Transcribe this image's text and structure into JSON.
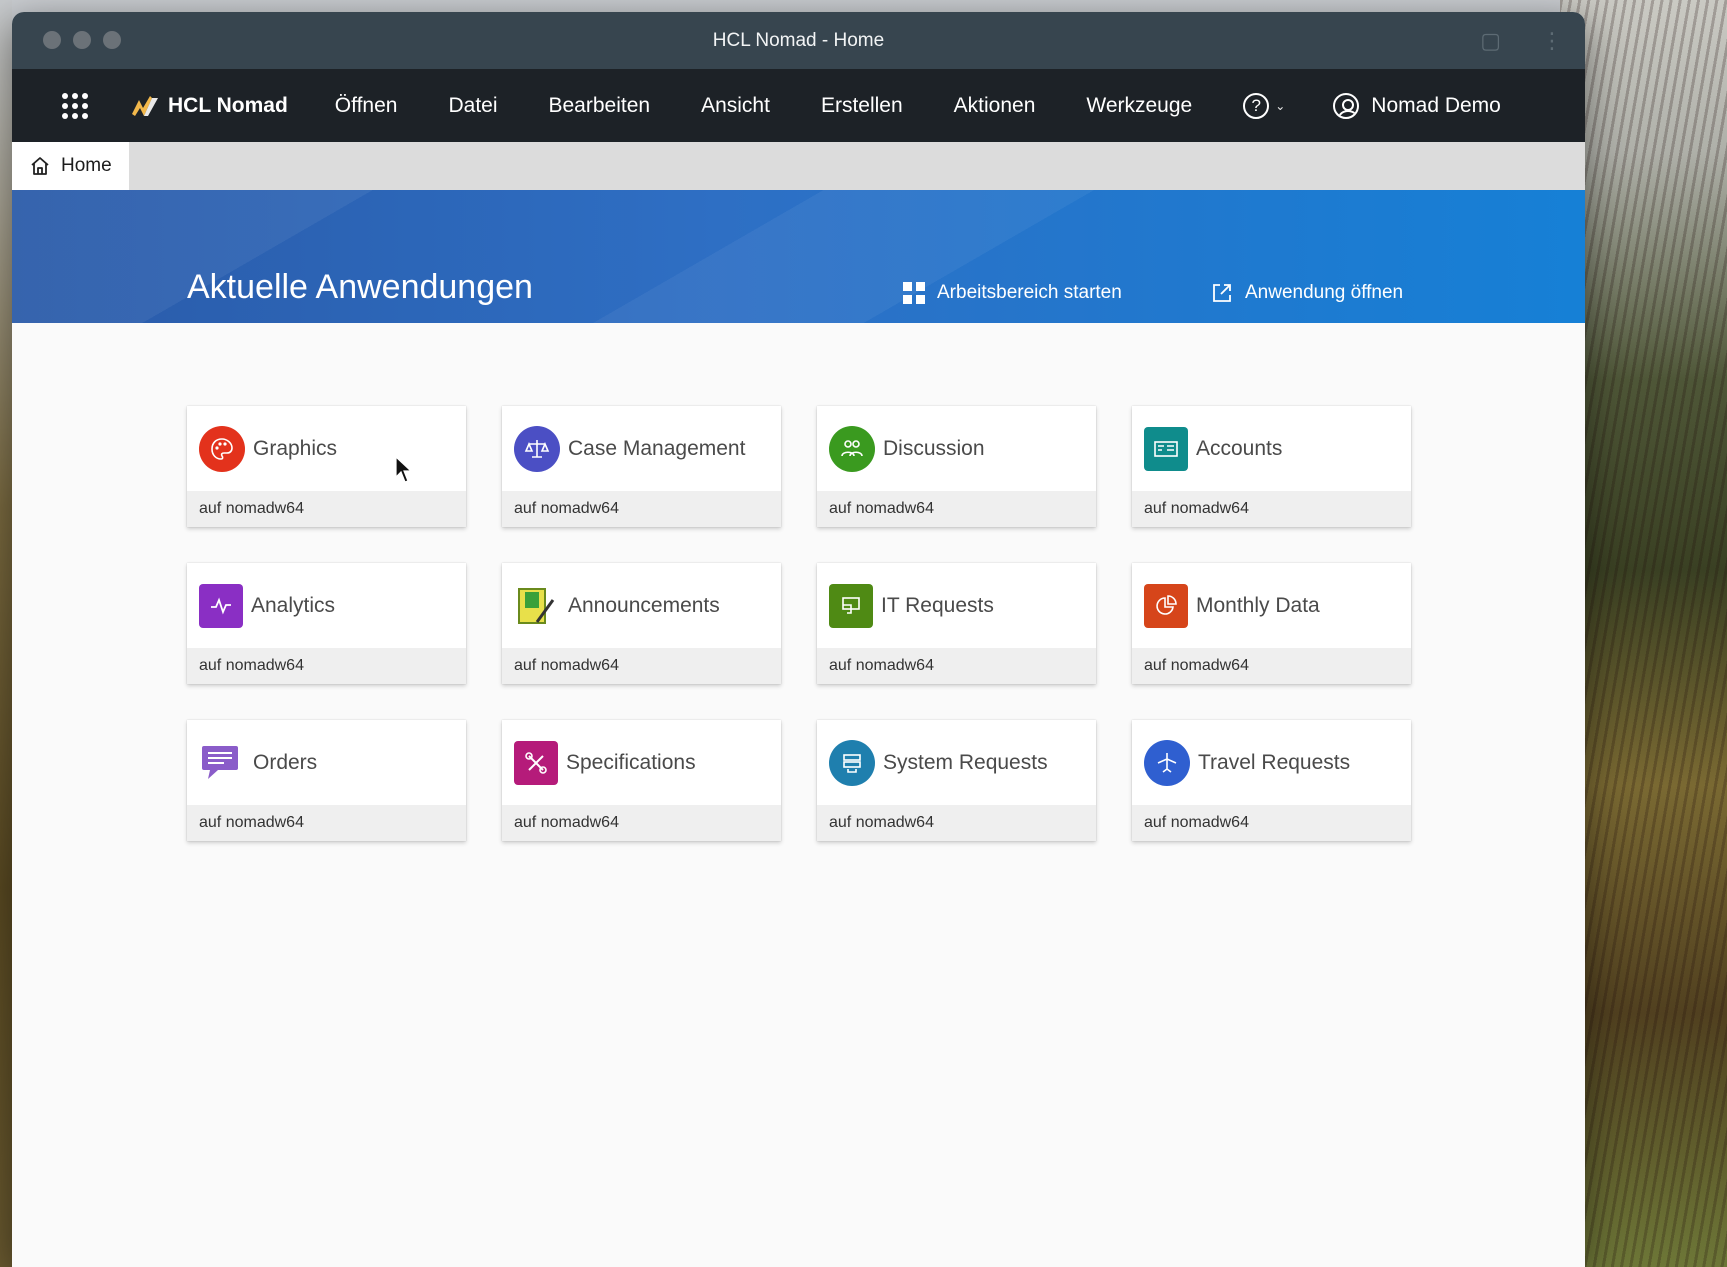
{
  "window": {
    "title": "HCL Nomad - Home"
  },
  "menubar": {
    "brand": "HCL Nomad",
    "items": [
      "Öffnen",
      "Datei",
      "Bearbeiten",
      "Ansicht",
      "Erstellen",
      "Aktionen",
      "Werkzeuge"
    ],
    "help_label": "?",
    "user": "Nomad Demo"
  },
  "tabs": [
    {
      "label": "Home",
      "icon": "home-icon"
    }
  ],
  "hero": {
    "title": "Aktuelle Anwendungen",
    "workspace_action": "Arbeitsbereich starten",
    "open_action": "Anwendung öffnen"
  },
  "apps": [
    {
      "name": "Graphics",
      "server": "auf nomadw64",
      "icon": "palette-icon",
      "color": "#e3321c"
    },
    {
      "name": "Case Management",
      "server": "auf nomadw64",
      "icon": "scales-icon",
      "color": "#4b4fc4"
    },
    {
      "name": "Discussion",
      "server": "auf nomadw64",
      "icon": "people-icon",
      "color": "#3a9a1f"
    },
    {
      "name": "Accounts",
      "server": "auf nomadw64",
      "icon": "id-card-icon",
      "color": "#0f8c8c"
    },
    {
      "name": "Analytics",
      "server": "auf nomadw64",
      "icon": "pulse-icon",
      "color": "#8a2fc4"
    },
    {
      "name": "Announcements",
      "server": "auf nomadw64",
      "icon": "notepad-icon",
      "color": "#c9c21e"
    },
    {
      "name": "IT Requests",
      "server": "auf nomadw64",
      "icon": "monitor-icon",
      "color": "#4f8a14"
    },
    {
      "name": "Monthly Data",
      "server": "auf nomadw64",
      "icon": "pie-chart-icon",
      "color": "#d6451a"
    },
    {
      "name": "Orders",
      "server": "auf nomadw64",
      "icon": "chat-bubble-icon",
      "color": "#8a5cc9"
    },
    {
      "name": "Specifications",
      "server": "auf nomadw64",
      "icon": "tools-icon",
      "color": "#b51b7a"
    },
    {
      "name": "System Requests",
      "server": "auf nomadw64",
      "icon": "server-icon",
      "color": "#1f7fae"
    },
    {
      "name": "Travel Requests",
      "server": "auf nomadw64",
      "icon": "airplane-icon",
      "color": "#2f5fd0"
    }
  ]
}
